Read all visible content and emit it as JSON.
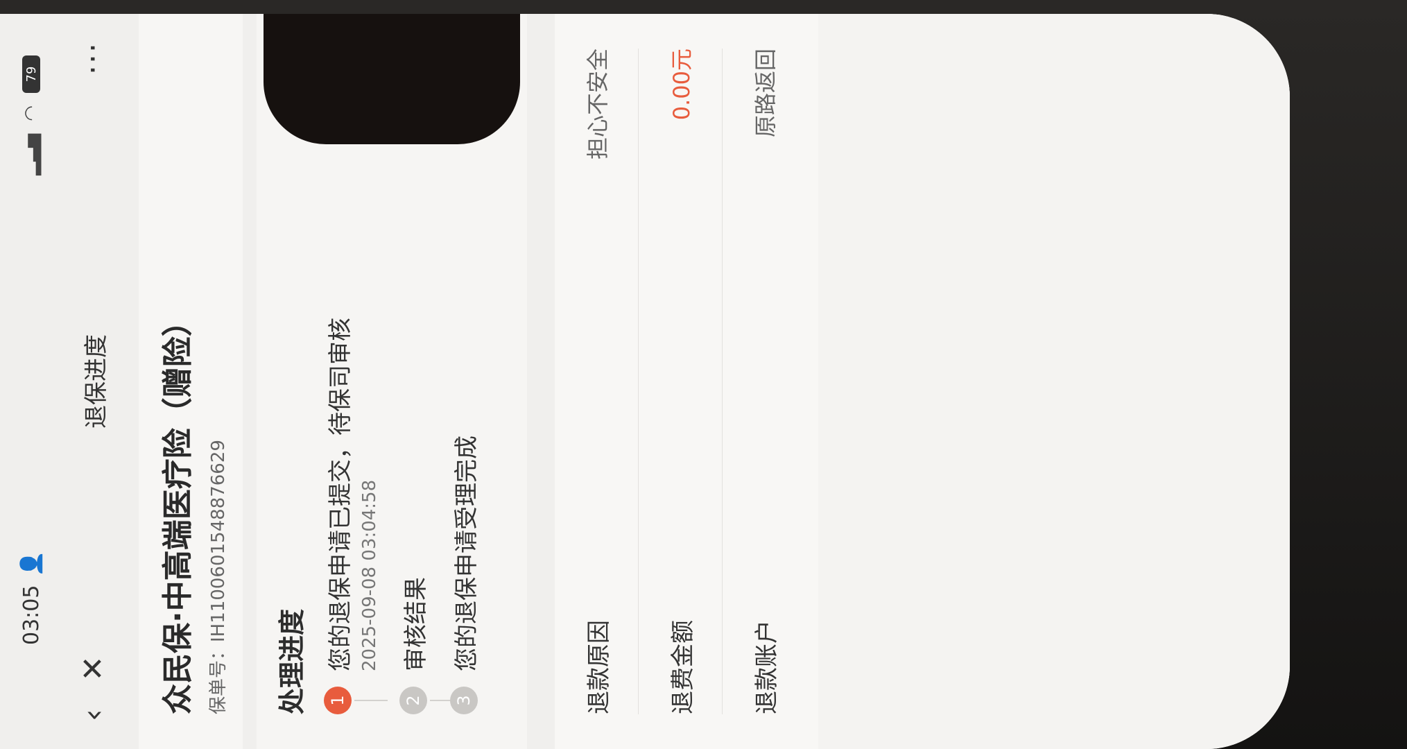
{
  "status_bar": {
    "time": "03:05",
    "battery": "79",
    "icons": [
      "person-icon",
      "signal-icon",
      "wifi-icon",
      "battery-icon"
    ]
  },
  "nav": {
    "title": "退保进度",
    "back_icon": "‹",
    "close_icon": "✕",
    "more_icon": "···"
  },
  "policy": {
    "title": "众民保·中高端医疗险（赠险）",
    "number_label": "保单号：",
    "number": "IH1100601548876629"
  },
  "progress": {
    "section_title": "处理进度",
    "steps": [
      {
        "index": "1",
        "title": "您的退保申请已提交，待保司审核",
        "time": "2025-09-08 03:04:58"
      },
      {
        "index": "2",
        "title": "审核结果",
        "time": ""
      },
      {
        "index": "3",
        "title": "您的退保申请受理完成",
        "time": ""
      }
    ]
  },
  "refund_info": {
    "rows": [
      {
        "label": "退款原因",
        "value": "担心不安全"
      },
      {
        "label": "退费金额",
        "value": "0.00元"
      },
      {
        "label": "退款账户",
        "value": "原路返回"
      }
    ]
  },
  "colors": {
    "accent": "#e85c3d",
    "page_bg": "#f0efed"
  }
}
